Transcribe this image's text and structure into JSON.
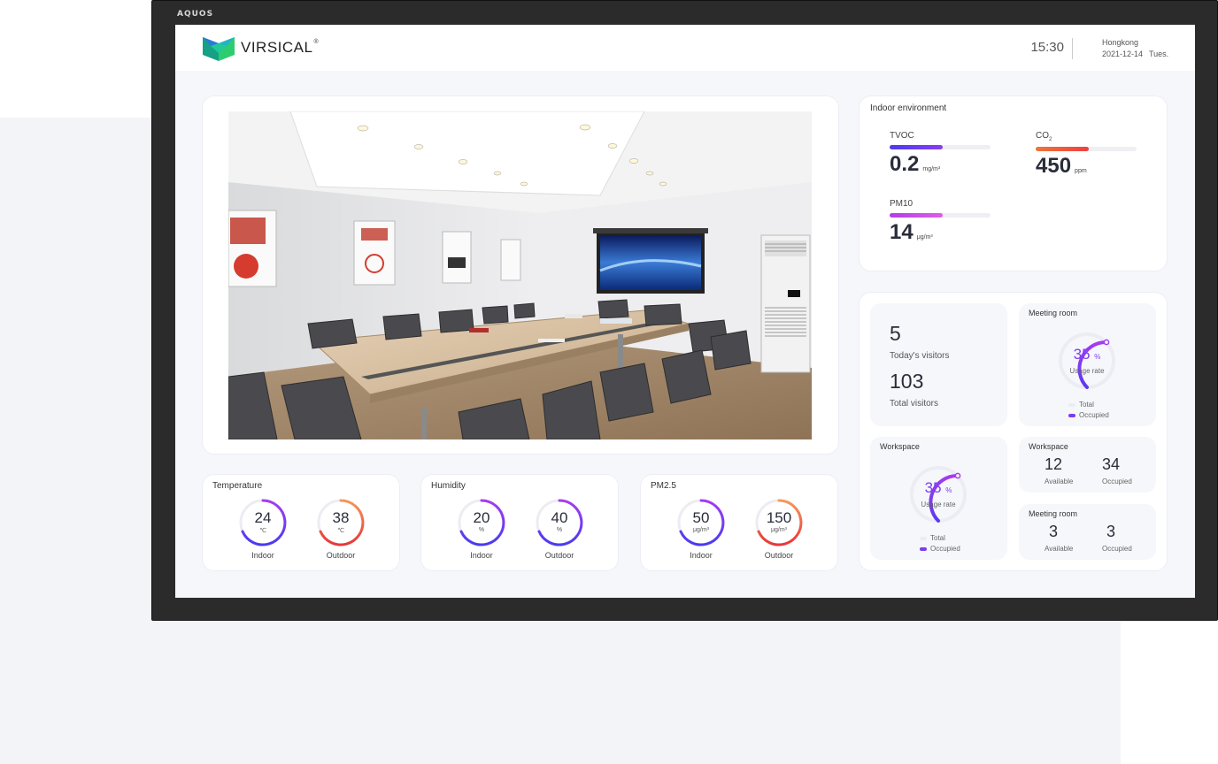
{
  "monitor": {
    "brand": "AQUOS"
  },
  "header": {
    "logo_text": "VIRSICAL",
    "registered": "®",
    "time": "15:30",
    "city": "Hongkong",
    "date": "2021-12-14",
    "weekday": "Tues."
  },
  "indoor_environment": {
    "title": "Indoor environment",
    "metrics": [
      {
        "label": "TVOC",
        "value": "0.2",
        "unit": "mg/m³",
        "level": 0.53
      },
      {
        "label": "CO",
        "label_sub": "2",
        "value": "450",
        "unit": "ppm",
        "level": 0.53
      },
      {
        "label": "PM10",
        "value": "14",
        "unit": "μg/m³",
        "level": 0.53
      }
    ]
  },
  "visitors": {
    "today_value": "5",
    "today_label": "Today's visitors",
    "total_value": "103",
    "total_label": "Total visitors"
  },
  "meeting_room_usage": {
    "title": "Meeting room",
    "rate": "35",
    "rate_unit": "%",
    "rate_label": "Usage rate",
    "legend_total": "Total",
    "legend_occupied": "Occupied"
  },
  "workspace_usage": {
    "title": "Workspace",
    "rate": "35",
    "rate_unit": "%",
    "rate_label": "Usage rate",
    "legend_total": "Total",
    "legend_occupied": "Occupied"
  },
  "workspace_stats": {
    "title": "Workspace",
    "available": "12",
    "available_label": "Available",
    "occupied": "34",
    "occupied_label": "Occupied"
  },
  "meeting_room_stats": {
    "title": "Meeting room",
    "available": "3",
    "available_label": "Available",
    "occupied": "3",
    "occupied_label": "Occupied"
  },
  "temperature": {
    "title": "Temperature",
    "indoor": "24",
    "indoor_unit": "℃",
    "indoor_label": "Indoor",
    "outdoor": "38",
    "outdoor_unit": "℃",
    "outdoor_label": "Outdoor"
  },
  "humidity": {
    "title": "Humidity",
    "indoor": "20",
    "indoor_unit": "%",
    "indoor_label": "Indoor",
    "outdoor": "40",
    "outdoor_unit": "%",
    "outdoor_label": "Outdoor"
  },
  "pm25": {
    "title": "PM2.5",
    "indoor": "50",
    "indoor_unit": "μg/m³",
    "indoor_label": "Indoor",
    "outdoor": "150",
    "outdoor_unit": "μg/m³",
    "outdoor_label": "Outdoor"
  },
  "colors": {
    "accent_purple": "#7b3cf5",
    "tvoc": "#5b3bf0",
    "co2": "#ef5a3a",
    "pm10": "#c03ee6",
    "outdoor_red": "#ef4d3c"
  }
}
